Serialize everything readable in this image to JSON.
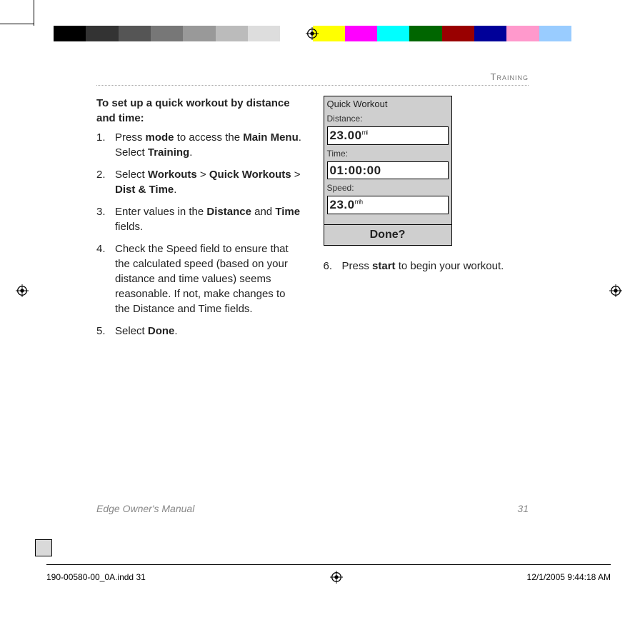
{
  "header_section": "Training",
  "heading": "To set up a quick workout by distance and time:",
  "steps_left": [
    {
      "pre": "Press ",
      "b1": "mode",
      "mid": " to access the ",
      "b2": "Main Menu",
      "mid2": ". Select ",
      "b3": "Training",
      "post": "."
    },
    {
      "pre": "Select ",
      "b1": "Workouts",
      "mid": " > ",
      "b2": "Quick Workouts",
      "mid2": " > ",
      "b3": "Dist & Time",
      "post": "."
    },
    {
      "pre": "Enter values in the ",
      "b1": "Distance",
      "mid": " and ",
      "b2": "Time",
      "post": " fields.",
      "b3": "",
      "mid2": ""
    },
    {
      "pre": "Check the Speed field to ensure that the calculated speed (based on your distance and time values) seems reasonable. If not, make changes to the Distance and Time fields.",
      "b1": "",
      "mid": "",
      "b2": "",
      "mid2": "",
      "b3": "",
      "post": ""
    },
    {
      "pre": "Select ",
      "b1": "Done",
      "mid": ".",
      "b2": "",
      "mid2": "",
      "b3": "",
      "post": ""
    }
  ],
  "step6": {
    "num": "6.",
    "pre": "Press ",
    "b1": "start",
    "post": " to begin your workout."
  },
  "device": {
    "title": "Quick Workout",
    "label_distance": "Distance:",
    "value_distance": "23.00",
    "unit_distance": "mi",
    "label_time": "Time:",
    "value_time": "01:00:00",
    "label_speed": "Speed:",
    "value_speed": "23.0",
    "unit_speed": "mh",
    "done": "Done?"
  },
  "footer_manual": "Edge Owner's Manual",
  "footer_page": "31",
  "imprint_file": "190-00580-00_0A.indd   31",
  "imprint_date": "12/1/2005   9:44:18 AM",
  "colorbar": [
    "#000",
    "#333",
    "#555",
    "#777",
    "#999",
    "#bbb",
    "#ddd",
    "#fff",
    "#ff0",
    "#f0f",
    "#0ff",
    "#060",
    "#900",
    "#009",
    "#f9c",
    "#9cf"
  ]
}
